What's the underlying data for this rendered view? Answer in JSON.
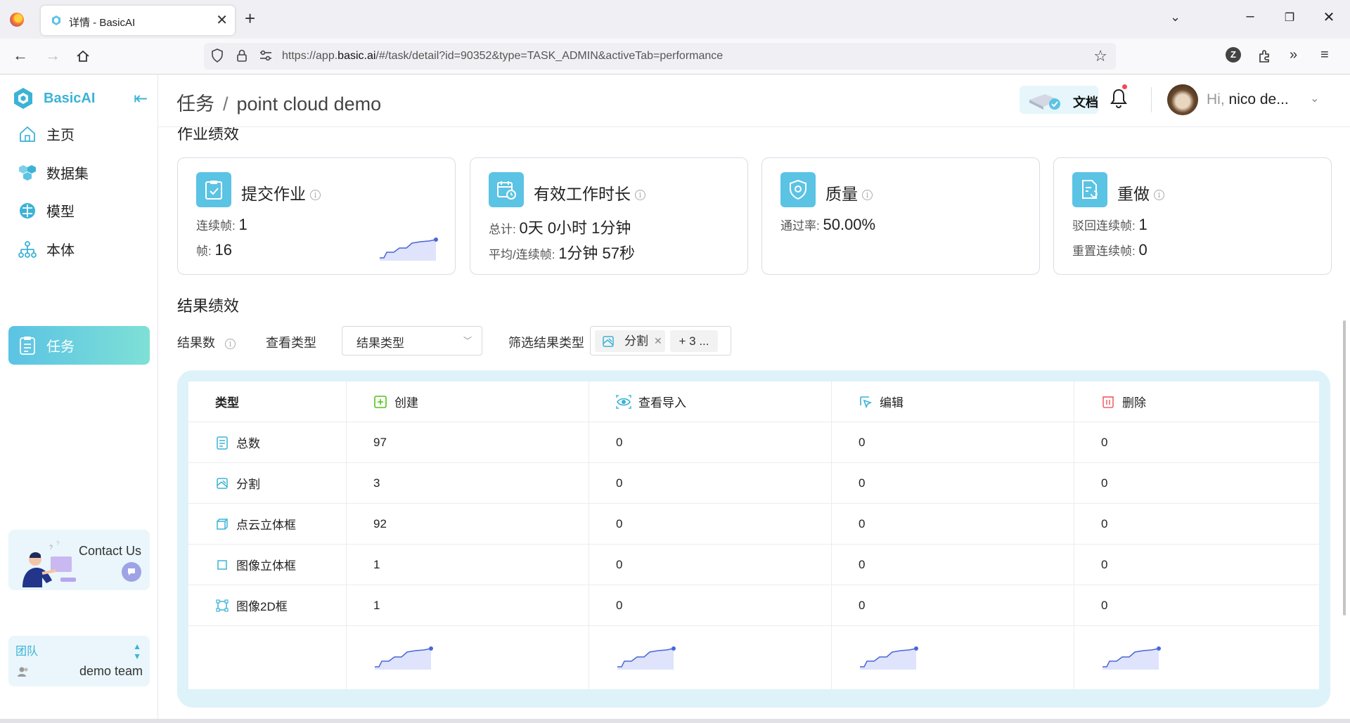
{
  "browser": {
    "tab_title": "详情 - BasicAI",
    "url_prefix": "https://app.",
    "url_domain": "basic.ai",
    "url_path": "/#/task/detail?id=90352&type=TASK_ADMIN&activeTab=performance"
  },
  "sidebar": {
    "brand": "BasicAI",
    "items": [
      {
        "label": "主页",
        "icon": "home-icon"
      },
      {
        "label": "数据集",
        "icon": "dataset-icon"
      },
      {
        "label": "模型",
        "icon": "model-icon"
      },
      {
        "label": "本体",
        "icon": "ontology-icon"
      },
      {
        "label": "任务",
        "icon": "task-icon",
        "active": true
      }
    ],
    "contact": "Contact Us",
    "team_label": "团队",
    "team_name": "demo team"
  },
  "header": {
    "breadcrumb_root": "任务",
    "breadcrumb_sep": "/",
    "breadcrumb_current": "point cloud demo",
    "doc_label": "文档",
    "greeting_hi": "Hi,",
    "greeting_name": "nico de..."
  },
  "work_performance": {
    "title": "作业绩效",
    "cards": [
      {
        "title": "提交作业",
        "lines": [
          {
            "label": "连续帧:",
            "value": "1"
          },
          {
            "label": "帧:",
            "value": "16"
          }
        ]
      },
      {
        "title": "有效工作时长",
        "lines": [
          {
            "label": "总计:",
            "value": "0天 0小时 1分钟"
          },
          {
            "label": "平均/连续帧:",
            "value": "1分钟 57秒"
          }
        ]
      },
      {
        "title": "质量",
        "lines": [
          {
            "label": "通过率:",
            "value": "50.00%"
          }
        ]
      },
      {
        "title": "重做",
        "lines": [
          {
            "label": "驳回连续帧:",
            "value": "1"
          },
          {
            "label": "重置连续帧:",
            "value": "0"
          }
        ]
      }
    ]
  },
  "result_performance": {
    "title": "结果绩效",
    "count_label": "结果数",
    "view_type_label": "查看类型",
    "view_type_value": "结果类型",
    "filter_label": "筛选结果类型",
    "filter_tag": "分割",
    "filter_more": "+ 3 ...",
    "table": {
      "headers": [
        "类型",
        "创建",
        "查看导入",
        "编辑",
        "删除"
      ],
      "rows": [
        {
          "type": "总数",
          "values": [
            "97",
            "0",
            "0",
            "0"
          ]
        },
        {
          "type": "分割",
          "values": [
            "3",
            "0",
            "0",
            "0"
          ]
        },
        {
          "type": "点云立体框",
          "values": [
            "92",
            "0",
            "0",
            "0"
          ]
        },
        {
          "type": "图像立体框",
          "values": [
            "1",
            "0",
            "0",
            "0"
          ]
        },
        {
          "type": "图像2D框",
          "values": [
            "1",
            "0",
            "0",
            "0"
          ]
        }
      ]
    }
  },
  "colors": {
    "accent": "#3bb3d6",
    "card_icon_bg": "#5bc3e4",
    "table_frame": "#def2fa",
    "active_menu_from": "#5bc3e4",
    "active_menu_to": "#7ee0d6"
  }
}
